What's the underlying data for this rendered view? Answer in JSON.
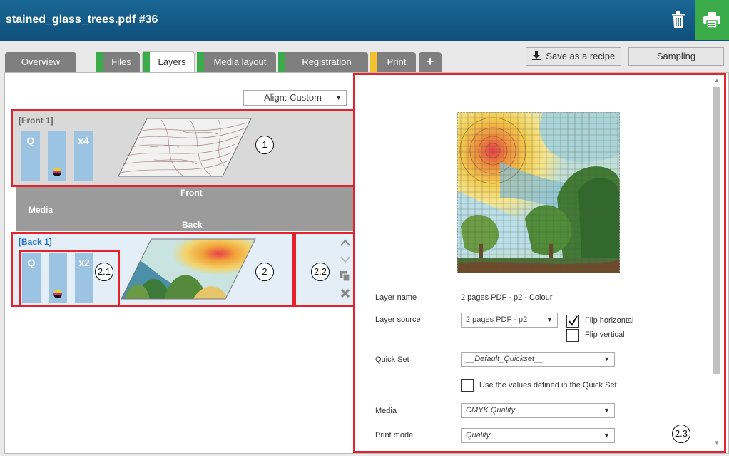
{
  "header": {
    "title": "stained_glass_trees.pdf #36",
    "trash_icon": "trash-icon",
    "print_icon": "printer-icon",
    "accent": "#3cab4a"
  },
  "tabs": [
    {
      "label": "Overview",
      "stripe": ""
    },
    {
      "label": "Files",
      "stripe": "#3cab4a"
    },
    {
      "label": "Layers",
      "stripe": "#3cab4a"
    },
    {
      "label": "Media layout",
      "stripe": "#3cab4a"
    },
    {
      "label": "Registration",
      "stripe": "#3cab4a"
    },
    {
      "label": "Print",
      "stripe": "#f2c230"
    }
  ],
  "tab_plus": "+",
  "actions": {
    "save_recipe": "Save as a recipe",
    "sampling": "Sampling"
  },
  "align": {
    "value": "Align: Custom"
  },
  "front_layer": {
    "title": "[Front 1]",
    "bar_q": "Q",
    "bar_x": "x4"
  },
  "media_band": {
    "front": "Front",
    "media": "Media",
    "back": "Back"
  },
  "back_layer": {
    "title": "[Back 1]",
    "bar_q": "Q",
    "bar_x": "x2"
  },
  "callouts": {
    "c1": "1",
    "c2": "2",
    "c21": "2.1",
    "c22": "2.2",
    "c23": "2.3"
  },
  "properties": {
    "layer_name_label": "Layer name",
    "layer_name_value": "2 pages PDF - p2 - Colour",
    "layer_source_label": "Layer source",
    "layer_source_value": "2 pages PDF - p2",
    "flip_horizontal": "Flip horizontal",
    "flip_vertical": "Flip vertical",
    "quick_set_label": "Quick Set",
    "quick_set_value": "__Default_Quickset__",
    "use_quickset": "Use the values defined in the Quick Set",
    "media_label": "Media",
    "media_value": "CMYK Quality",
    "print_mode_label": "Print mode",
    "print_mode_value": "Quality"
  },
  "flip_horizontal_checked": true,
  "flip_vertical_checked": false,
  "use_quickset_checked": false
}
